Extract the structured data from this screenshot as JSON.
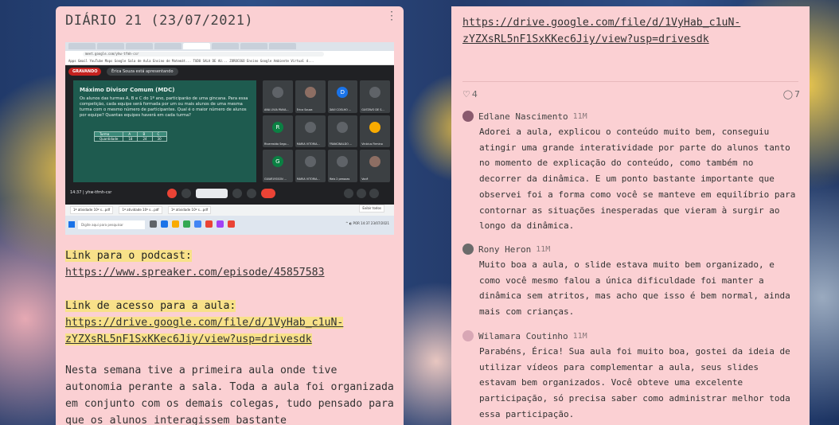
{
  "left": {
    "title": "DIÁRIO 21 (23/07/2021)",
    "menu_icon": "kebab-menu-icon",
    "screenshot": {
      "url": "meet.google.com/yhw-tfmh-csr",
      "bookmarks": "Apps   Gmail   YouTube   Maps   Google Sala de Aula   Ensino de Matemát...   TUDO SALA DE AU...   ZOROCOGO Ensino   Google   Ambiente Virtual d...",
      "recording_label": "GRAVANDO",
      "presenting_label": "Érica Souza está apresentando",
      "slide_title": "Máximo Divisor Comum (MDC)",
      "slide_text": "Os alunos das turmas A, B e C do 1º ano, participarão de uma gincana. Para essa competição, cada equipe será formada por um ou mais alunos de uma mesma turma com o mesmo número de participantes. Qual é o maior número de alunos por equipe? Quantas equipes haverá em cada turma?",
      "table": [
        [
          "Turma",
          "A",
          "B",
          "C"
        ],
        [
          "Quantidade",
          "18",
          "24",
          "30"
        ]
      ],
      "participants": [
        {
          "name": "ANA LÍVIA PAIVA...",
          "initial": "",
          "color": "#5f6368"
        },
        {
          "name": "Érica Souza",
          "initial": "",
          "color": "#8d6e63"
        },
        {
          "name": "DAVI COELHO ...",
          "initial": "D",
          "color": "#1a73e8"
        },
        {
          "name": "GUSTAVO DE S...",
          "initial": "",
          "color": "#5f6368"
        },
        {
          "name": "Riverealdo Sego...",
          "initial": "R",
          "color": "#0b8043"
        },
        {
          "name": "MARIA VITÓRIA...",
          "initial": "",
          "color": "#5f6368"
        },
        {
          "name": "FRANCINALDO ...",
          "initial": "",
          "color": "#5f6368"
        },
        {
          "name": "Vinícius Firmino",
          "initial": "",
          "color": "#f9ab00"
        },
        {
          "name": "GILWELYSSON ...",
          "initial": "G",
          "color": "#0b8043"
        },
        {
          "name": "MARIA VITÓRIA...",
          "initial": "",
          "color": "#5f6368"
        },
        {
          "name": "Mais 2 pessoas",
          "initial": "",
          "color": "#5f6368"
        },
        {
          "name": "Você",
          "initial": "",
          "color": "#8d6e63"
        }
      ],
      "meet_time": "14:37  |  yhw-tfmh-csr",
      "downloads": [
        "1ª atividade 10º s...pdf",
        "1ª atividade 10º s...pdf",
        "1ª atividade 10º s...pdf"
      ],
      "downloads_show_all": "Exibir todos",
      "taskbar_search": "Digite aqui para pesquisar",
      "taskbar_tray": "^  ◐ POR  14:37 23/07/2021"
    },
    "podcast_label": "Link para o podcast:",
    "podcast_url": "https://www.spreaker.com/episode/45857583",
    "class_label": "Link de acesso para a aula:",
    "class_url_line1": "https://drive.google.com/file/d/1VyHab_c1uN-",
    "class_url_line2": "zYZXsRL5nF1SxKKec6Jiy/view?usp=drivesdk",
    "body": "Nesta semana tive a primeira aula onde tive autonomia perante a sala. Toda a aula foi organizada em conjunto com os demais colegas, tudo pensado para que os alunos interagissem bastante"
  },
  "right": {
    "url_line1": "https://drive.google.com/file/d/1VyHab_c1uN-",
    "url_line2": "zYZXsRL5nF1SxKKec6Jiy/view?usp=drivesdk",
    "likes": "4",
    "comments_count": "7",
    "comments": [
      {
        "author": "Edlane Nascimento",
        "time": "11M",
        "text": "Adorei a aula, explicou o conteúdo muito bem, conseguiu atingir uma grande interatividade por parte do alunos tanto no momento de explicação do conteúdo, como também no decorrer da dinâmica. E um ponto bastante importante que observei foi a forma como você se manteve em equilíbrio para contornar as situações inesperadas que vieram à surgir ao longo da dinâmica."
      },
      {
        "author": "Rony Heron",
        "time": "11M",
        "text": "Muito boa a aula, o slide estava muito bem organizado, e como você mesmo falou a única dificuldade foi manter a dinâmica sem atritos, mas acho que isso é bem normal, ainda mais com crianças."
      },
      {
        "author": "Wilamara Coutinho",
        "time": "11M",
        "text": "Parabéns, Érica! Sua aula foi muito boa, gostei da ideia de utilizar vídeos para complementar a aula, seus slides estavam bem organizados. Você obteve uma excelente participação, só precisa saber como administrar melhor toda essa participação."
      }
    ]
  }
}
